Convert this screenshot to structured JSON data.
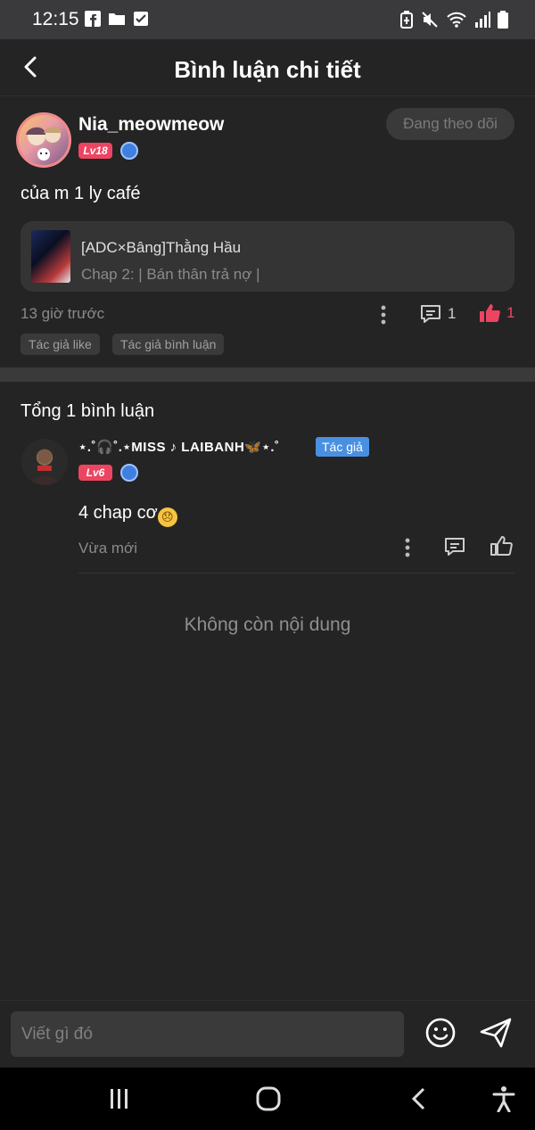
{
  "status_bar": {
    "time": "12:15",
    "left_icons": [
      "facebook-icon",
      "folder-icon",
      "checkbox-icon"
    ],
    "right_icons": [
      "battery-saver-icon",
      "mute-icon",
      "wifi-icon",
      "signal-icon",
      "battery-icon"
    ]
  },
  "header": {
    "title": "Bình luận chi tiết",
    "back_icon": "chevron-left-icon"
  },
  "post": {
    "username": "Nia_meowmeow",
    "level": "Lv18",
    "follow_label": "Đang theo dõi",
    "text": "của m 1 ly café",
    "card": {
      "title": "[ADC×Bâng]Thằng Hầu",
      "subtitle": "Chap 2: | Bán thân trả nợ |"
    },
    "time": "13 giờ trước",
    "reply_count": "1",
    "like_count": "1",
    "tags": [
      "Tác giả like",
      "Tác giả bình luận"
    ]
  },
  "replies": {
    "total_label": "Tổng 1 bình luận",
    "items": [
      {
        "username": "⋆.˚🎧˚.⋆MISS ♪ LAIBANH🦋⋆.˚",
        "level": "Lv6",
        "badge": "Tác giả",
        "text": "4 chap cơ",
        "emoji": "😞",
        "time": "Vừa mới"
      }
    ],
    "end_label": "Không còn nội dung"
  },
  "composer": {
    "placeholder": "Viết gì đó"
  },
  "colors": {
    "background": "#242424",
    "accent_like": "#ec4561",
    "author_badge": "#4a90e2"
  }
}
